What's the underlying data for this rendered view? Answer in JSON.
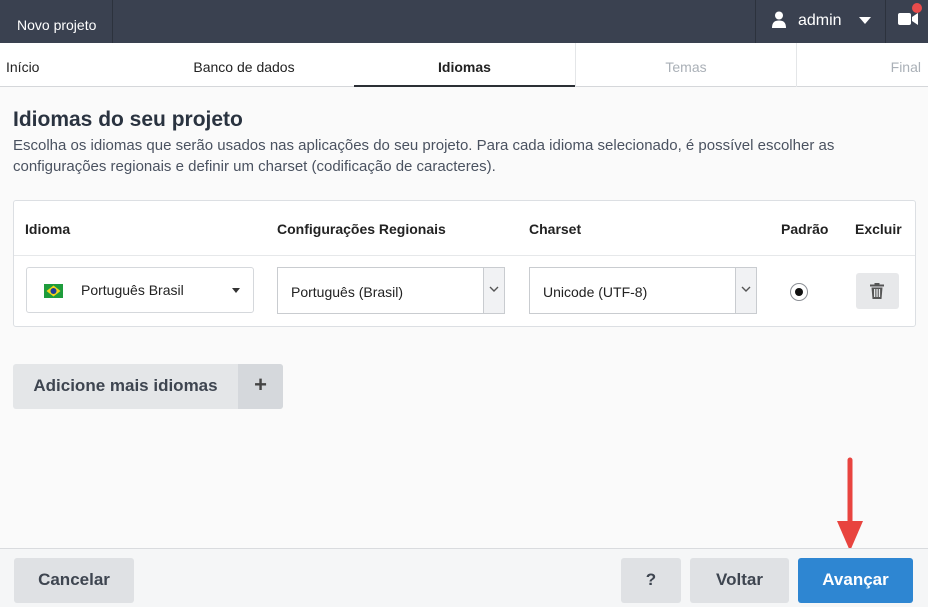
{
  "topbar": {
    "project_tab": "Novo projeto",
    "user_name": "admin",
    "user_icon": "user-icon",
    "video_icon": "video-camera-icon",
    "notification_color": "#e84b4b"
  },
  "steps": [
    {
      "label": "Início",
      "state": "done"
    },
    {
      "label": "Banco de dados",
      "state": "done"
    },
    {
      "label": "Idiomas",
      "state": "active"
    },
    {
      "label": "Temas",
      "state": "disabled"
    },
    {
      "label": "Final",
      "state": "disabled"
    }
  ],
  "main": {
    "title": "Idiomas do seu projeto",
    "description": "Escolha os idiomas que serão usados nas aplicações do seu projeto. Para cada idioma selecionado, é possível escolher as configurações regionais e definir um charset (codificação de caracteres)."
  },
  "table": {
    "headers": {
      "language": "Idioma",
      "regional": "Configurações Regionais",
      "charset": "Charset",
      "default": "Padrão",
      "delete": "Excluir"
    },
    "rows": [
      {
        "language": "Português Brasil",
        "flag_icon": "brazil-flag-icon",
        "regional": "Português (Brasil)",
        "charset": "Unicode (UTF-8)",
        "is_default": true
      }
    ]
  },
  "add_more": {
    "label": "Adicione mais idiomas",
    "plus": "+"
  },
  "footer": {
    "cancel": "Cancelar",
    "help": "?",
    "back": "Voltar",
    "next": "Avançar"
  },
  "colors": {
    "topbar": "#3a4150",
    "primary": "#2e86d2",
    "annotation_arrow": "#e8443f"
  }
}
